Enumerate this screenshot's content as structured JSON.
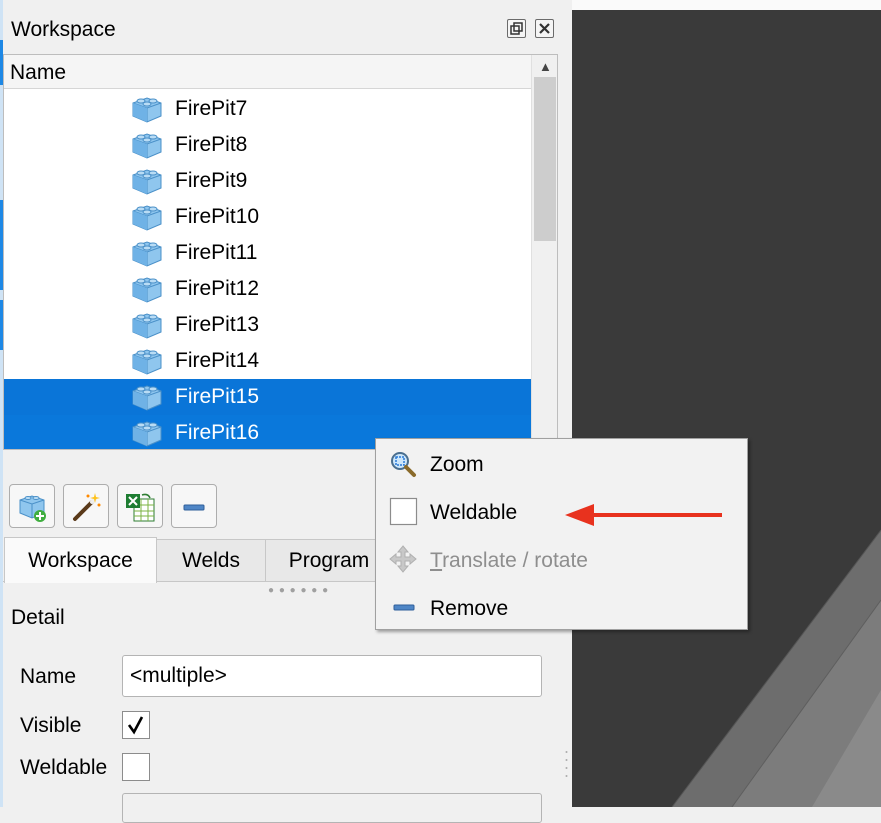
{
  "panel": {
    "title": "Workspace",
    "float_icon": "float-window-icon",
    "close_icon": "close-icon"
  },
  "tree": {
    "column_header": "Name",
    "item_icon": "lego-brick-icon",
    "items": [
      {
        "label": "FirePit7",
        "selected": false
      },
      {
        "label": "FirePit8",
        "selected": false
      },
      {
        "label": "FirePit9",
        "selected": false
      },
      {
        "label": "FirePit10",
        "selected": false
      },
      {
        "label": "FirePit11",
        "selected": false
      },
      {
        "label": "FirePit12",
        "selected": false
      },
      {
        "label": "FirePit13",
        "selected": false
      },
      {
        "label": "FirePit14",
        "selected": false
      },
      {
        "label": "FirePit15",
        "selected": true
      },
      {
        "label": "FirePit16",
        "selected": true
      }
    ]
  },
  "toolbar": {
    "buttons": [
      {
        "icon": "add-brick-icon"
      },
      {
        "icon": "magic-wand-icon"
      },
      {
        "icon": "excel-import-icon"
      },
      {
        "icon": "remove-icon"
      }
    ]
  },
  "tabs": [
    {
      "label": "Workspace",
      "active": true
    },
    {
      "label": "Welds",
      "active": false
    },
    {
      "label": "Program",
      "active": false
    }
  ],
  "detail": {
    "title": "Detail",
    "name_label": "Name",
    "name_value": "<multiple>",
    "visible_label": "Visible",
    "visible_checked": true,
    "weldable_label": "Weldable",
    "weldable_checked": false
  },
  "context_menu": {
    "items": [
      {
        "label": "Zoom",
        "icon": "zoom-icon",
        "enabled": true
      },
      {
        "label": "Weldable",
        "icon": "checkbox-icon",
        "enabled": true
      },
      {
        "label": "Translate / rotate",
        "icon": "move-arrows-icon",
        "enabled": false
      },
      {
        "label": "Remove",
        "icon": "remove-icon",
        "enabled": true
      }
    ]
  },
  "colors": {
    "selection": "#0a75d8",
    "viewport": "#3a3a3a",
    "arrow": "#e8321e"
  }
}
